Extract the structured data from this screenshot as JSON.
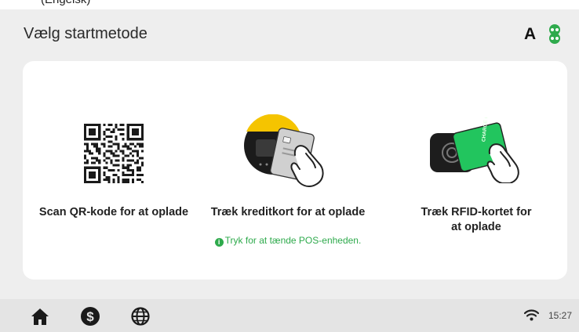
{
  "top_strip": {
    "text": "(Engelsk)"
  },
  "header": {
    "title": "Vælg startmetode",
    "language_badge": "A"
  },
  "options": [
    {
      "label": "Scan QR-kode for at oplade",
      "icon": "qr-code-icon"
    },
    {
      "label": "Træk kreditkort for at oplade",
      "icon": "credit-card-terminal-icon",
      "hint": "Tryk for at tænde POS-enheden.",
      "hint_icon": "info-icon"
    },
    {
      "label": "Træk RFID-kortet for at oplade",
      "icon": "rfid-card-icon",
      "card_text": "CHARGE CARD"
    }
  ],
  "bottom_bar": {
    "nav": [
      "home-icon",
      "dollar-icon",
      "globe-icon"
    ],
    "time": "15:27"
  },
  "colors": {
    "accent_green": "#2eaa4c",
    "card_green": "#22c55e",
    "terminal_yellow": "#f5c400"
  }
}
